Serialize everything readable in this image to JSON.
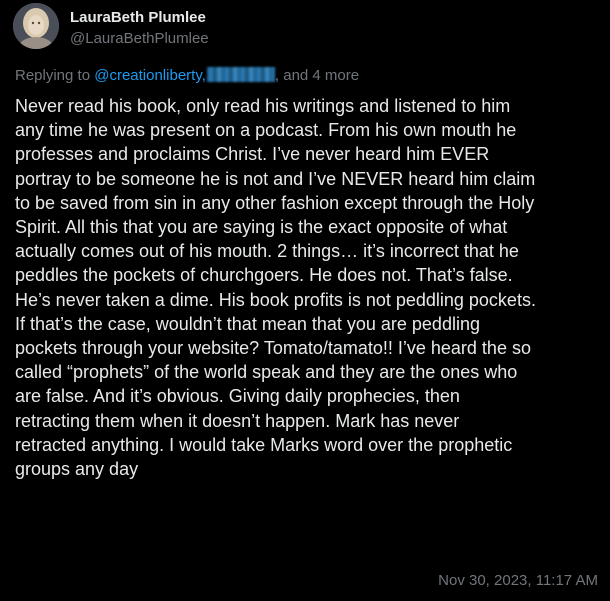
{
  "author": {
    "name": "LauraBeth Plumlee",
    "handle": "@LauraBethPlumlee"
  },
  "reply": {
    "prefix": "Replying to",
    "mention": "@creationliberty",
    "separator": ",",
    "suffix": ", and 4 more"
  },
  "tweet": {
    "lines": [
      "Never read his book, only read his writings and listened to him",
      "any time he was present on a podcast. From his own mouth he",
      "professes and proclaims Christ. I’ve never heard him EVER",
      "portray to be someone he is not and I’ve NEVER heard him claim",
      "to be saved from sin in any other fashion except through the Holy",
      "Spirit. All this that you are saying is the exact opposite of what",
      "actually comes out of his mouth. 2 things… it’s incorrect that he",
      "peddles the pockets of churchgoers. He does not. That’s false.",
      "He’s never taken a dime. His book profits is not peddling pockets.",
      "If that’s the case, wouldn’t that mean that you are peddling",
      "pockets through your website? Tomato/tamato!! I’ve heard the so",
      "called “prophets” of the world speak and they are the ones who",
      "are false. And it’s obvious. Giving daily prophecies, then",
      "retracting them when it doesn’t happen. Mark has never",
      "retracted anything. I would take Marks word over the prophetic",
      "groups any day"
    ]
  },
  "timestamp": "Nov 30, 2023, 11:17 AM",
  "colors": {
    "background": "#000000",
    "text": "#e7e9ea",
    "muted": "#71767b",
    "link": "#1d9bf0"
  }
}
